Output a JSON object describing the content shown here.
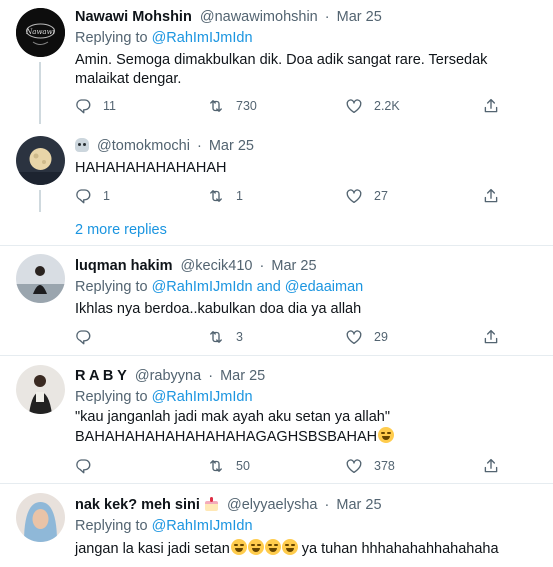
{
  "tweets": [
    {
      "name": "Nawawi Mohshin",
      "handle": "@nawawimohshin",
      "dot": "·",
      "date": "Mar 25",
      "replying_label": "Replying to",
      "replying_to": "@RahImIJmIdn",
      "text": "Amin. Semoga dimakbulkan dik. Doa adik sangat rare. Tersedak malaikat dengar.",
      "replies": "11",
      "retweets": "730",
      "likes": "2.2K"
    },
    {
      "name_icon": "skull-icon",
      "handle": "@tomokmochi",
      "dot": "·",
      "date": "Mar 25",
      "text": "HAHAHAHAHAHAHAH",
      "replies": "1",
      "retweets": "1",
      "likes": "27"
    },
    {
      "more_replies": "2 more replies"
    },
    {
      "name": "luqman hakim",
      "handle": "@kecik410",
      "dot": "·",
      "date": "Mar 25",
      "replying_label": "Replying to",
      "replying_to": "@RahImIJmIdn",
      "and_label": "and",
      "replying_to_2": "@edaaiman",
      "text": "Ikhlas nya berdoa..kabulkan doa dia ya allah",
      "replies": "",
      "retweets": "3",
      "likes": "29"
    },
    {
      "name": "R A B Y",
      "handle": "@rabyyna",
      "dot": "·",
      "date": "Mar 25",
      "replying_label": "Replying to",
      "replying_to": "@RahImIJmIdn",
      "text_line1": "\"kau janganlah jadi mak ayah aku setan ya allah\"",
      "text_line2": "BAHAHAHAHAHAHAHAHAGAGHSBSBAHAH",
      "replies": "",
      "retweets": "50",
      "likes": "378"
    },
    {
      "name": "nak kek? meh sini",
      "name_icon": "cake-icon",
      "handle": "@elyyaelysha",
      "dot": "·",
      "date": "Mar 25",
      "replying_label": "Replying to",
      "replying_to": "@RahImIJmIdn",
      "text_before": "jangan la kasi jadi setan",
      "text_after": " ya tuhan hhhahahahhahahaha"
    }
  ],
  "colors": {
    "link": "#1b95e0",
    "muted": "#536471",
    "divider": "#e6ecf0"
  }
}
